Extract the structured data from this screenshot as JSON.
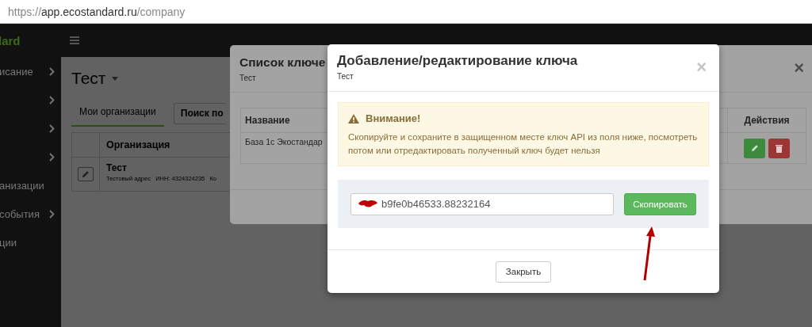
{
  "address_bar": {
    "url_parts": [
      {
        "text": "https://",
        "kind": "faint"
      },
      {
        "text": "app.ecostandard.ru",
        "kind": "strong"
      },
      {
        "text": "/company",
        "kind": "faint"
      }
    ]
  },
  "sidebar": {
    "logo": "lard",
    "items": [
      {
        "label": "исание",
        "chevron": true
      },
      {
        "chevron": true
      },
      {
        "chevron": true
      },
      {
        "chevron": true
      },
      {
        "label": "анизации",
        "chevron": false
      },
      {
        "label": "события",
        "chevron": true
      },
      {
        "label": "ции",
        "chevron": false
      }
    ]
  },
  "main": {
    "title": "Тест",
    "tabs": [
      {
        "label": "Мои организации",
        "selected": true
      }
    ],
    "search": {
      "placeholder": "Поиск по"
    },
    "table": {
      "columns": [
        "Организация"
      ],
      "rows": [
        {
          "name": "Тест",
          "details": "Тестовый адрес   ИНН: 4324324235   Ко"
        }
      ]
    }
  },
  "back_modal": {
    "title": "Список ключе",
    "subtitle": "Тест",
    "close_icon": "×",
    "table": {
      "columns": [
        "Название",
        "Действия"
      ],
      "rows": [
        {
          "name": "База 1с Экостандар"
        }
      ]
    }
  },
  "front_modal": {
    "title": "Добавление/редактирование ключа",
    "subtitle": "Тест",
    "close_icon": "×",
    "alert": {
      "title": "Внимание!",
      "text": "Скопируйте и сохраните в защищенном месте ключ API из поля ниже, посмотреть потом или отредактировать полученный ключ будет нельзя"
    },
    "key_value": "b9fe0b46533.88232164",
    "copy_button": "Скопировать",
    "close_button": "Закрыть"
  }
}
